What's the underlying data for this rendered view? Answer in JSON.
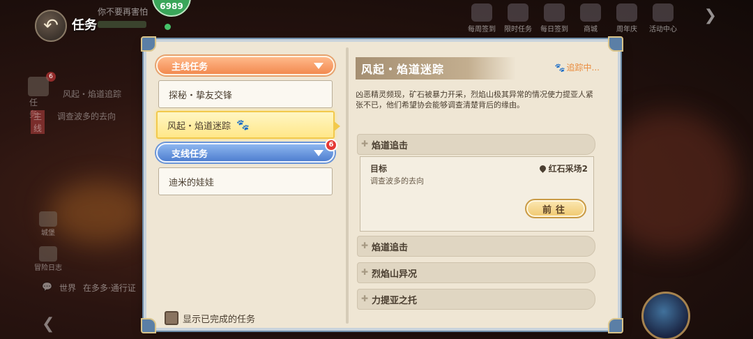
{
  "header": {
    "title": "任务",
    "hud_text": "你不要再害怕",
    "badge_value": "6989"
  },
  "top_menu": [
    {
      "label": "每周签到"
    },
    {
      "label": "限时任务"
    },
    {
      "label": "每日签到"
    },
    {
      "label": "商城"
    },
    {
      "label": "周年庆"
    },
    {
      "label": "活动中心"
    }
  ],
  "side_hud": {
    "quest_label": "任务",
    "quest_badge": "6",
    "quest_text": "风起・焰道追踪",
    "quest_sub": "调查波多的去向",
    "tag": "主线",
    "item1": "城堡",
    "item2": "冒险日志",
    "chat_world": "世界",
    "chat_text": "在多多·通行证"
  },
  "categories": {
    "main": {
      "label": "主线任务"
    },
    "side": {
      "label": "支线任务",
      "badge": "6"
    }
  },
  "main_quests": [
    {
      "label": "探秘・挚友交锋",
      "selected": false
    },
    {
      "label": "风起・焰道迷踪",
      "selected": true
    }
  ],
  "side_quests": [
    {
      "label": "迪米的娃娃"
    }
  ],
  "show_completed_label": "显示已完成的任务",
  "detail": {
    "title": "风起・焰道迷踪",
    "tracking": "追踪中...",
    "description": "凶恶精灵频现，矿石被暴力开采，烈焰山极其异常的情况使力提亚人紧张不已，他们希望协会能够调查清楚背后的缘由。",
    "sections": [
      {
        "label": "焰道追击",
        "expanded": true
      },
      {
        "label": "焰道追击",
        "expanded": false
      },
      {
        "label": "烈焰山异况",
        "expanded": false
      },
      {
        "label": "力提亚之托",
        "expanded": false
      }
    ],
    "objective": {
      "label": "目标",
      "text": "调查波多的去向",
      "location": "红石采场2",
      "go_label": "前往"
    }
  }
}
